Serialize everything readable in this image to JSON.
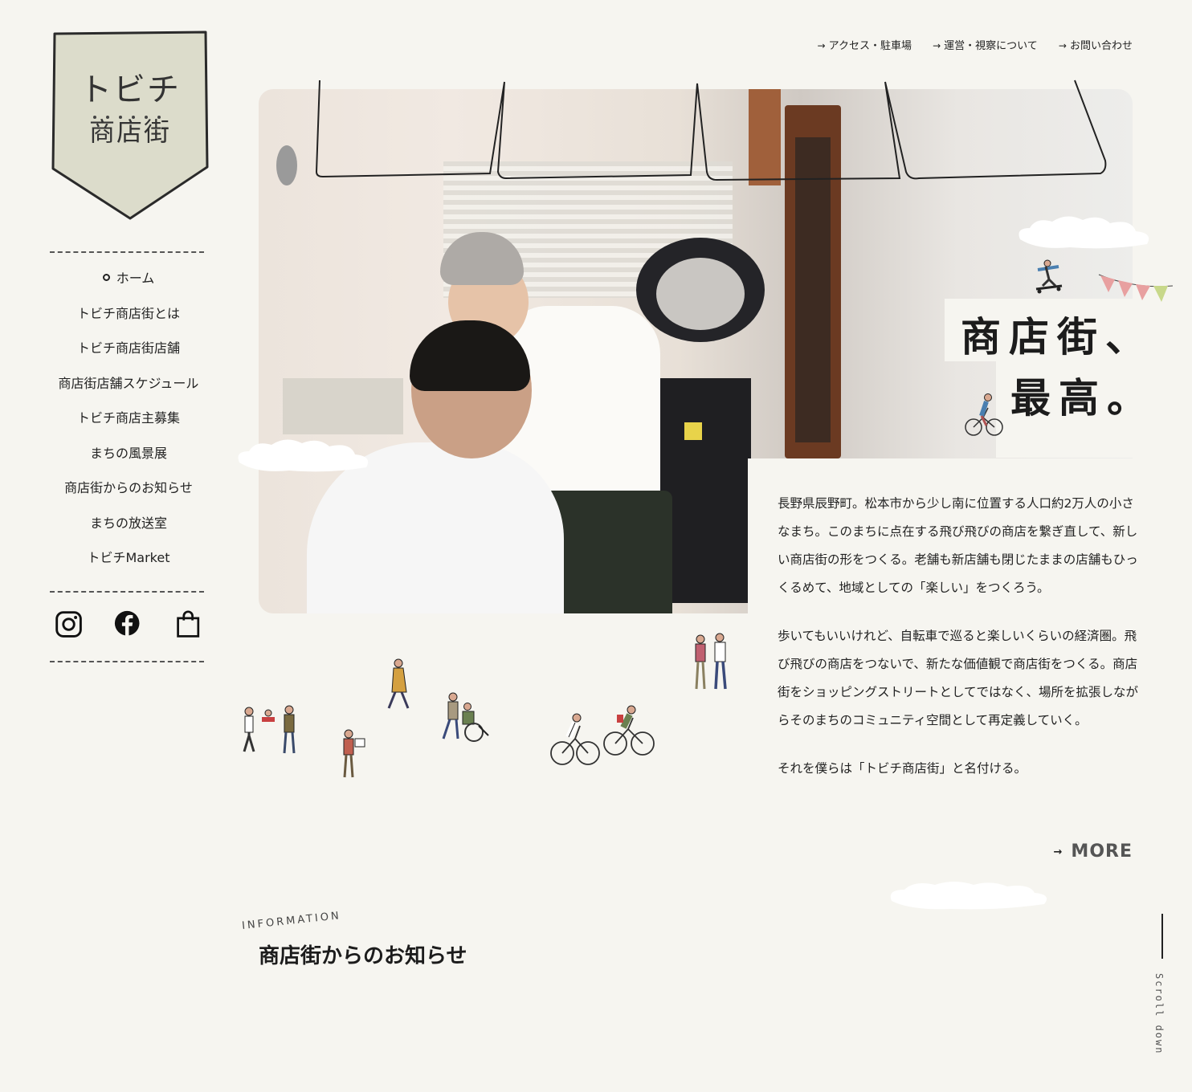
{
  "logo": {
    "line1": "トビチ",
    "line2": "商店街"
  },
  "top_links": [
    {
      "label": "アクセス・駐車場"
    },
    {
      "label": "運営・視察について"
    },
    {
      "label": "お問い合わせ"
    }
  ],
  "nav": [
    {
      "label": "ホーム",
      "active": true
    },
    {
      "label": "トビチ商店街とは"
    },
    {
      "label": "トビチ商店街店舗"
    },
    {
      "label": "商店街店舗スケジュール"
    },
    {
      "label": "トビチ商店主募集"
    },
    {
      "label": "まちの風景展"
    },
    {
      "label": "商店街からのお知らせ"
    },
    {
      "label": "まちの放送室"
    },
    {
      "label": "トビチMarket"
    }
  ],
  "social": [
    {
      "icon": "instagram-icon"
    },
    {
      "icon": "facebook-icon"
    },
    {
      "icon": "shopping-bag-icon"
    }
  ],
  "hero": {
    "catch_line1": "商店街、",
    "catch_line2": "最高。"
  },
  "copy": {
    "p1": "長野県辰野町。松本市から少し南に位置する人口約2万人の小さなまち。このまちに点在する飛び飛びの商店を繋ぎ直して、新しい商店街の形をつくる。老舗も新店舗も閉じたままの店舗もひっくるめて、地域としての「楽しい」をつくろう。",
    "p2": "歩いてもいいけれど、自転車で巡ると楽しいくらいの経済圏。飛び飛びの商店をつないで、新たな価値観で商店街をつくる。商店街をショッピングストリートとしてではなく、場所を拡張しながらそのまちのコミュニティ空間として再定義していく。",
    "p3": "それを僕らは「トビチ商店街」と名付ける。"
  },
  "more_label": "MORE",
  "information": {
    "en": "INFORMATION",
    "ja": "商店街からのお知らせ"
  },
  "scroll_label": "Scroll down",
  "colors": {
    "background": "#f6f5f0",
    "logo_fill": "#dcdccb",
    "flag_pink": "#e8a0a0",
    "flag_green": "#c8d88a"
  }
}
